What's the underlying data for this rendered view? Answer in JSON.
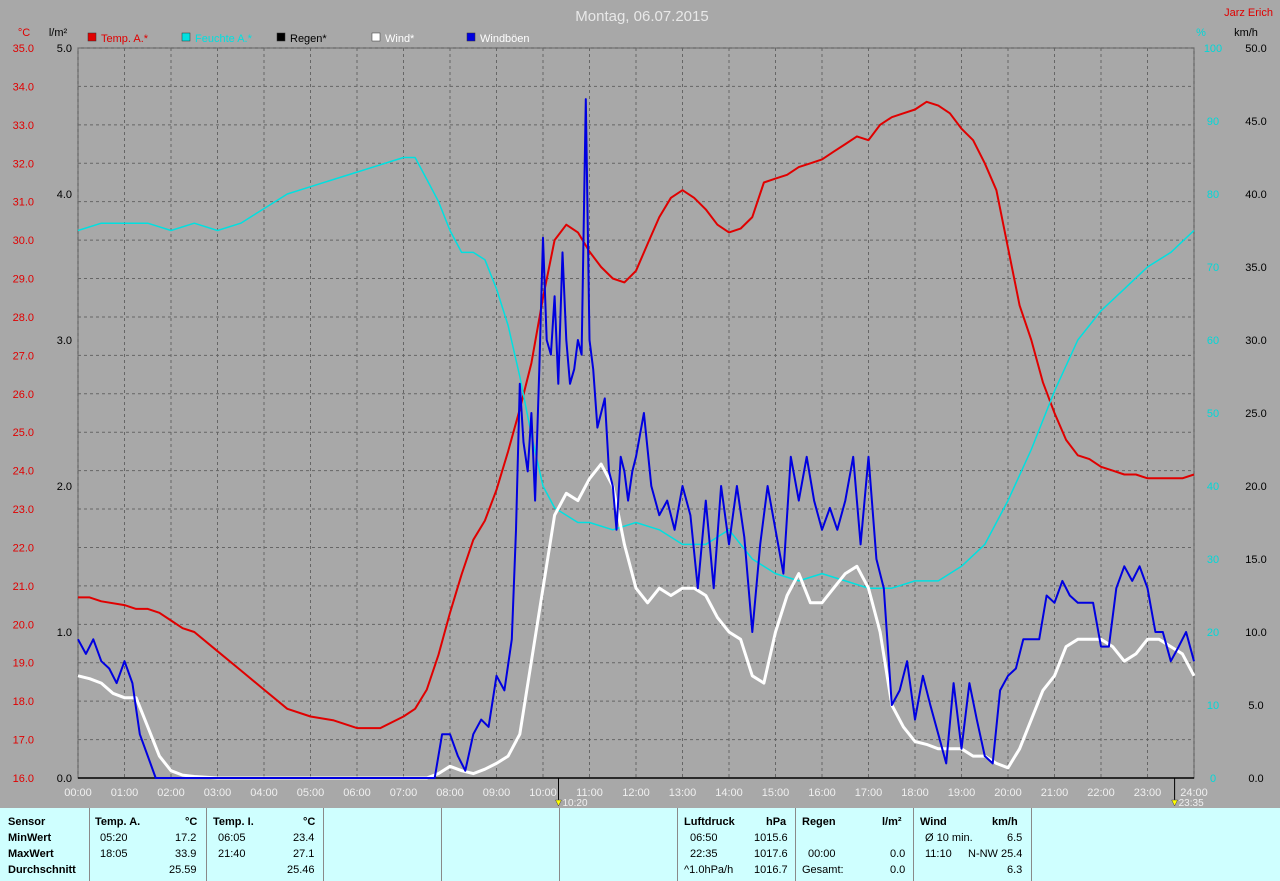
{
  "chart_data": {
    "type": "line",
    "title": "Montag, 06.07.2015",
    "author": "Jarz Erich",
    "x_axis": {
      "range": [
        "00:00",
        "24:00"
      ],
      "ticks": [
        "00:00",
        "01:00",
        "02:00",
        "03:00",
        "04:00",
        "05:00",
        "06:00",
        "07:00",
        "08:00",
        "09:00",
        "10:00",
        "11:00",
        "12:00",
        "13:00",
        "14:00",
        "15:00",
        "16:00",
        "17:00",
        "18:00",
        "19:00",
        "20:00",
        "21:00",
        "22:00",
        "23:00",
        "24:00"
      ],
      "markers": [
        {
          "label": "10:20",
          "x": 10.333
        },
        {
          "label": "23:35",
          "x": 23.583
        }
      ]
    },
    "y_axes": {
      "temp": {
        "unit": "°C",
        "range": [
          16.0,
          35.0
        ],
        "ticks": [
          "16.0",
          "17.0",
          "18.0",
          "19.0",
          "20.0",
          "21.0",
          "22.0",
          "23.0",
          "24.0",
          "25.0",
          "26.0",
          "27.0",
          "28.0",
          "29.0",
          "30.0",
          "31.0",
          "32.0",
          "33.0",
          "34.0",
          "35.0"
        ],
        "color": "#e00000"
      },
      "rain": {
        "unit": "l/m²",
        "range": [
          0.0,
          5.0
        ],
        "ticks": [
          "0.0",
          "1.0",
          "2.0",
          "3.0",
          "4.0",
          "5.0"
        ],
        "color": "#000000"
      },
      "humidity": {
        "unit": "%",
        "range": [
          0,
          100
        ],
        "ticks": [
          "0",
          "10",
          "20",
          "30",
          "40",
          "50",
          "60",
          "70",
          "80",
          "90",
          "100"
        ],
        "color": "#00d8d8"
      },
      "wind": {
        "unit": "km/h",
        "range": [
          0.0,
          50.0
        ],
        "ticks": [
          "0.0",
          "5.0",
          "10.0",
          "15.0",
          "20.0",
          "25.0",
          "30.0",
          "35.0",
          "40.0",
          "45.0",
          "50.0"
        ],
        "color": "#000000"
      }
    },
    "grid": true,
    "legend_position": "top",
    "series": [
      {
        "name": "Temp. A.*",
        "axis": "temp",
        "color": "#e00000",
        "x": [
          0,
          0.25,
          0.5,
          1,
          1.25,
          1.5,
          1.75,
          2,
          2.25,
          2.5,
          3,
          3.5,
          4,
          4.5,
          5,
          5.5,
          6,
          6.5,
          7,
          7.25,
          7.5,
          7.75,
          8,
          8.25,
          8.5,
          8.75,
          9,
          9.25,
          9.5,
          9.75,
          10,
          10.25,
          10.5,
          10.75,
          11,
          11.25,
          11.5,
          11.75,
          12,
          12.25,
          12.5,
          12.75,
          13,
          13.25,
          13.5,
          13.75,
          14,
          14.25,
          14.5,
          14.75,
          15,
          15.25,
          15.5,
          15.75,
          16,
          16.25,
          16.5,
          16.75,
          17,
          17.25,
          17.5,
          17.75,
          18,
          18.25,
          18.5,
          18.75,
          19,
          19.25,
          19.5,
          19.75,
          20,
          20.25,
          20.5,
          20.75,
          21,
          21.25,
          21.5,
          21.75,
          22,
          22.25,
          22.5,
          22.75,
          23,
          23.25,
          23.5,
          23.75,
          24
        ],
        "values": [
          20.7,
          20.7,
          20.6,
          20.5,
          20.4,
          20.4,
          20.3,
          20.1,
          19.9,
          19.8,
          19.3,
          18.8,
          18.3,
          17.8,
          17.6,
          17.5,
          17.3,
          17.3,
          17.6,
          17.8,
          18.3,
          19.2,
          20.3,
          21.3,
          22.2,
          22.7,
          23.5,
          24.5,
          25.6,
          26.8,
          28.5,
          30.0,
          30.4,
          30.2,
          29.7,
          29.3,
          29.0,
          28.9,
          29.2,
          29.9,
          30.6,
          31.1,
          31.3,
          31.1,
          30.8,
          30.4,
          30.2,
          30.3,
          30.6,
          31.5,
          31.6,
          31.7,
          31.9,
          32.0,
          32.1,
          32.3,
          32.5,
          32.7,
          32.6,
          33.0,
          33.2,
          33.3,
          33.4,
          33.6,
          33.5,
          33.3,
          32.9,
          32.6,
          32.0,
          31.3,
          29.8,
          28.3,
          27.4,
          26.3,
          25.5,
          24.8,
          24.4,
          24.3,
          24.1,
          24.0,
          23.9,
          23.9,
          23.8,
          23.8,
          23.8,
          23.8,
          23.9
        ]
      },
      {
        "name": "Feuchte A.*",
        "axis": "humidity",
        "color": "#00e0e0",
        "x": [
          0,
          0.5,
          1,
          1.5,
          2,
          2.5,
          3,
          3.5,
          4,
          4.5,
          5,
          5.5,
          6,
          6.5,
          7,
          7.25,
          7.5,
          7.75,
          8,
          8.25,
          8.5,
          8.75,
          9,
          9.25,
          9.5,
          9.75,
          10,
          10.25,
          10.5,
          10.75,
          11,
          11.5,
          12,
          12.5,
          13,
          13.5,
          14,
          14.5,
          15,
          15.5,
          16,
          16.5,
          17,
          17.5,
          18,
          18.5,
          19,
          19.5,
          20,
          20.5,
          21,
          21.5,
          22,
          22.5,
          23,
          23.5,
          24
        ],
        "values": [
          75,
          76,
          76,
          76,
          75,
          76,
          75,
          76,
          78,
          80,
          81,
          82,
          83,
          84,
          85,
          85,
          82,
          79,
          75,
          72,
          72,
          71,
          67,
          62,
          55,
          47,
          40,
          37,
          36,
          35,
          35,
          34,
          35,
          34,
          32,
          32,
          34,
          30,
          28,
          27,
          28,
          27,
          26,
          26,
          27,
          27,
          29,
          32,
          38,
          45,
          53,
          60,
          64,
          67,
          70,
          72,
          75
        ]
      },
      {
        "name": "Regen*",
        "axis": "rain",
        "color": "#000000",
        "x": [
          0,
          24
        ],
        "values": [
          0.0,
          0.0
        ]
      },
      {
        "name": "Wind*",
        "axis": "wind",
        "color": "#ffffff",
        "x": [
          0,
          0.25,
          0.5,
          0.75,
          1,
          1.25,
          1.5,
          1.75,
          2,
          2.25,
          2.5,
          3,
          3.5,
          4,
          4.5,
          5,
          5.5,
          6,
          6.5,
          7,
          7.5,
          7.75,
          8,
          8.25,
          8.5,
          8.75,
          9,
          9.25,
          9.5,
          9.75,
          10,
          10.25,
          10.5,
          10.75,
          11,
          11.25,
          11.5,
          11.75,
          12,
          12.25,
          12.5,
          12.75,
          13,
          13.25,
          13.5,
          13.75,
          14,
          14.25,
          14.5,
          14.75,
          15,
          15.25,
          15.5,
          15.75,
          16,
          16.25,
          16.5,
          16.75,
          17,
          17.25,
          17.5,
          17.75,
          18,
          18.25,
          18.5,
          18.75,
          19,
          19.25,
          19.5,
          19.75,
          20,
          20.25,
          20.5,
          20.75,
          21,
          21.25,
          21.5,
          21.75,
          22,
          22.25,
          22.5,
          22.75,
          23,
          23.25,
          23.5,
          23.75,
          24
        ],
        "values": [
          7.0,
          6.8,
          6.5,
          5.8,
          5.5,
          5.5,
          3.5,
          1.5,
          0.5,
          0.2,
          0.1,
          0.0,
          0.0,
          0.0,
          0.0,
          0.0,
          0.0,
          0.0,
          0.0,
          0.0,
          0.0,
          0.3,
          0.8,
          0.5,
          0.3,
          0.6,
          1.0,
          1.5,
          3.0,
          8.0,
          13.0,
          18.0,
          19.5,
          19.0,
          20.5,
          21.5,
          20.0,
          16.0,
          13.0,
          12.0,
          13.0,
          12.5,
          13.0,
          13.0,
          12.5,
          11.0,
          10.0,
          9.5,
          7.0,
          6.5,
          10.0,
          12.5,
          14.0,
          12.0,
          12.0,
          13.0,
          14.0,
          14.5,
          13.0,
          10.0,
          5.0,
          3.5,
          2.5,
          2.3,
          2.0,
          2.0,
          2.0,
          1.5,
          1.5,
          1.0,
          0.7,
          2.0,
          4.0,
          6.0,
          7.0,
          9.0,
          9.5,
          9.5,
          9.5,
          9.0,
          8.0,
          8.5,
          9.5,
          9.5,
          9.0,
          8.5,
          7.0
        ]
      },
      {
        "name": "Windböen",
        "axis": "wind",
        "color": "#0000e0",
        "x": [
          0,
          0.17,
          0.33,
          0.5,
          0.67,
          0.83,
          1,
          1.17,
          1.33,
          1.5,
          1.67,
          1.83,
          2,
          7.67,
          7.83,
          8.0,
          8.17,
          8.33,
          8.5,
          8.67,
          8.83,
          9.0,
          9.17,
          9.33,
          9.42,
          9.5,
          9.58,
          9.67,
          9.75,
          9.83,
          9.92,
          10.0,
          10.08,
          10.17,
          10.25,
          10.33,
          10.42,
          10.5,
          10.58,
          10.67,
          10.75,
          10.83,
          10.92,
          11.0,
          11.08,
          11.17,
          11.25,
          11.33,
          11.42,
          11.5,
          11.58,
          11.67,
          11.75,
          11.83,
          11.92,
          12.0,
          12.17,
          12.33,
          12.5,
          12.67,
          12.83,
          13.0,
          13.17,
          13.33,
          13.5,
          13.67,
          13.83,
          14.0,
          14.17,
          14.33,
          14.5,
          14.67,
          14.83,
          15.0,
          15.17,
          15.33,
          15.5,
          15.67,
          15.83,
          16.0,
          16.17,
          16.33,
          16.5,
          16.67,
          16.83,
          17.0,
          17.17,
          17.33,
          17.5,
          17.67,
          17.83,
          18.0,
          18.17,
          18.33,
          18.5,
          18.67,
          18.83,
          19.0,
          19.17,
          19.33,
          19.5,
          19.67,
          19.83,
          20.0,
          20.17,
          20.33,
          20.5,
          20.67,
          20.83,
          21.0,
          21.17,
          21.33,
          21.5,
          21.67,
          21.83,
          22.0,
          22.17,
          22.33,
          22.5,
          22.67,
          22.83,
          23.0,
          23.17,
          23.33,
          23.5,
          23.67,
          23.83,
          24.0
        ],
        "values": [
          9.5,
          8.5,
          9.5,
          8.0,
          7.5,
          6.5,
          8.0,
          6.5,
          3.0,
          1.5,
          0.0,
          0.0,
          0.0,
          0.0,
          3.0,
          3.0,
          1.5,
          0.5,
          3.0,
          4.0,
          3.5,
          7.0,
          6.0,
          9.5,
          17.0,
          27.0,
          23.0,
          21.0,
          25.0,
          19.0,
          28.0,
          37.0,
          30.0,
          29.0,
          33.0,
          27.0,
          36.0,
          30.0,
          27.0,
          28.0,
          30.0,
          29.0,
          46.5,
          30.0,
          28.0,
          24.0,
          25.0,
          26.0,
          21.0,
          20.0,
          17.0,
          22.0,
          21.0,
          19.0,
          21.0,
          22.0,
          25.0,
          20.0,
          18.0,
          19.0,
          17.0,
          20.0,
          18.0,
          13.0,
          19.0,
          13.0,
          20.0,
          16.0,
          20.0,
          16.5,
          10.0,
          16.0,
          20.0,
          17.0,
          14.0,
          22.0,
          19.0,
          22.0,
          19.0,
          17.0,
          18.5,
          17.0,
          19.0,
          22.0,
          16.0,
          22.0,
          15.0,
          13.0,
          5.0,
          6.0,
          8.0,
          4.0,
          7.0,
          5.0,
          3.0,
          1.0,
          6.5,
          2.0,
          6.5,
          4.0,
          1.5,
          1.0,
          6.0,
          7.0,
          7.5,
          9.5,
          9.5,
          9.5,
          12.5,
          12.0,
          13.5,
          12.5,
          12.0,
          12.0,
          12.0,
          9.0,
          9.0,
          13.0,
          14.5,
          13.5,
          14.5,
          13.0,
          10.0,
          10.0,
          8.0,
          9.0,
          10.0,
          8.0
        ]
      }
    ]
  },
  "table": {
    "sensor": {
      "header": "Sensor",
      "rows": [
        "MinWert",
        "MaxWert",
        "Durchschnitt"
      ]
    },
    "temp_a": {
      "header": "Temp. A.",
      "unit": "°C",
      "min_time": "05:20",
      "min_val": "17.2",
      "max_time": "18:05",
      "max_val": "33.9",
      "avg": "25.59"
    },
    "temp_i": {
      "header": "Temp. I.",
      "unit": "°C",
      "min_time": "06:05",
      "min_val": "23.4",
      "max_time": "21:40",
      "max_val": "27.1",
      "avg": "25.46"
    },
    "luftdruck": {
      "header": "Luftdruck",
      "unit": "hPa",
      "min_time": "06:50",
      "min_val": "1015.6",
      "max_time": "22:35",
      "max_val": "1017.6",
      "trend_label": "^1.0hPa/h",
      "trend_val": "1016.7"
    },
    "regen": {
      "header": "Regen",
      "unit": "l/m²",
      "time": "00:00",
      "val": "0.0",
      "total_label": "Gesamt:",
      "total_val": "0.0"
    },
    "wind": {
      "header": "Wind",
      "unit": "km/h",
      "avg10_label": "Ø 10 min.",
      "avg10_val": "6.5",
      "max_time": "11:10",
      "max_val": "N-NW 25.4",
      "avg_val": "6.3"
    }
  }
}
